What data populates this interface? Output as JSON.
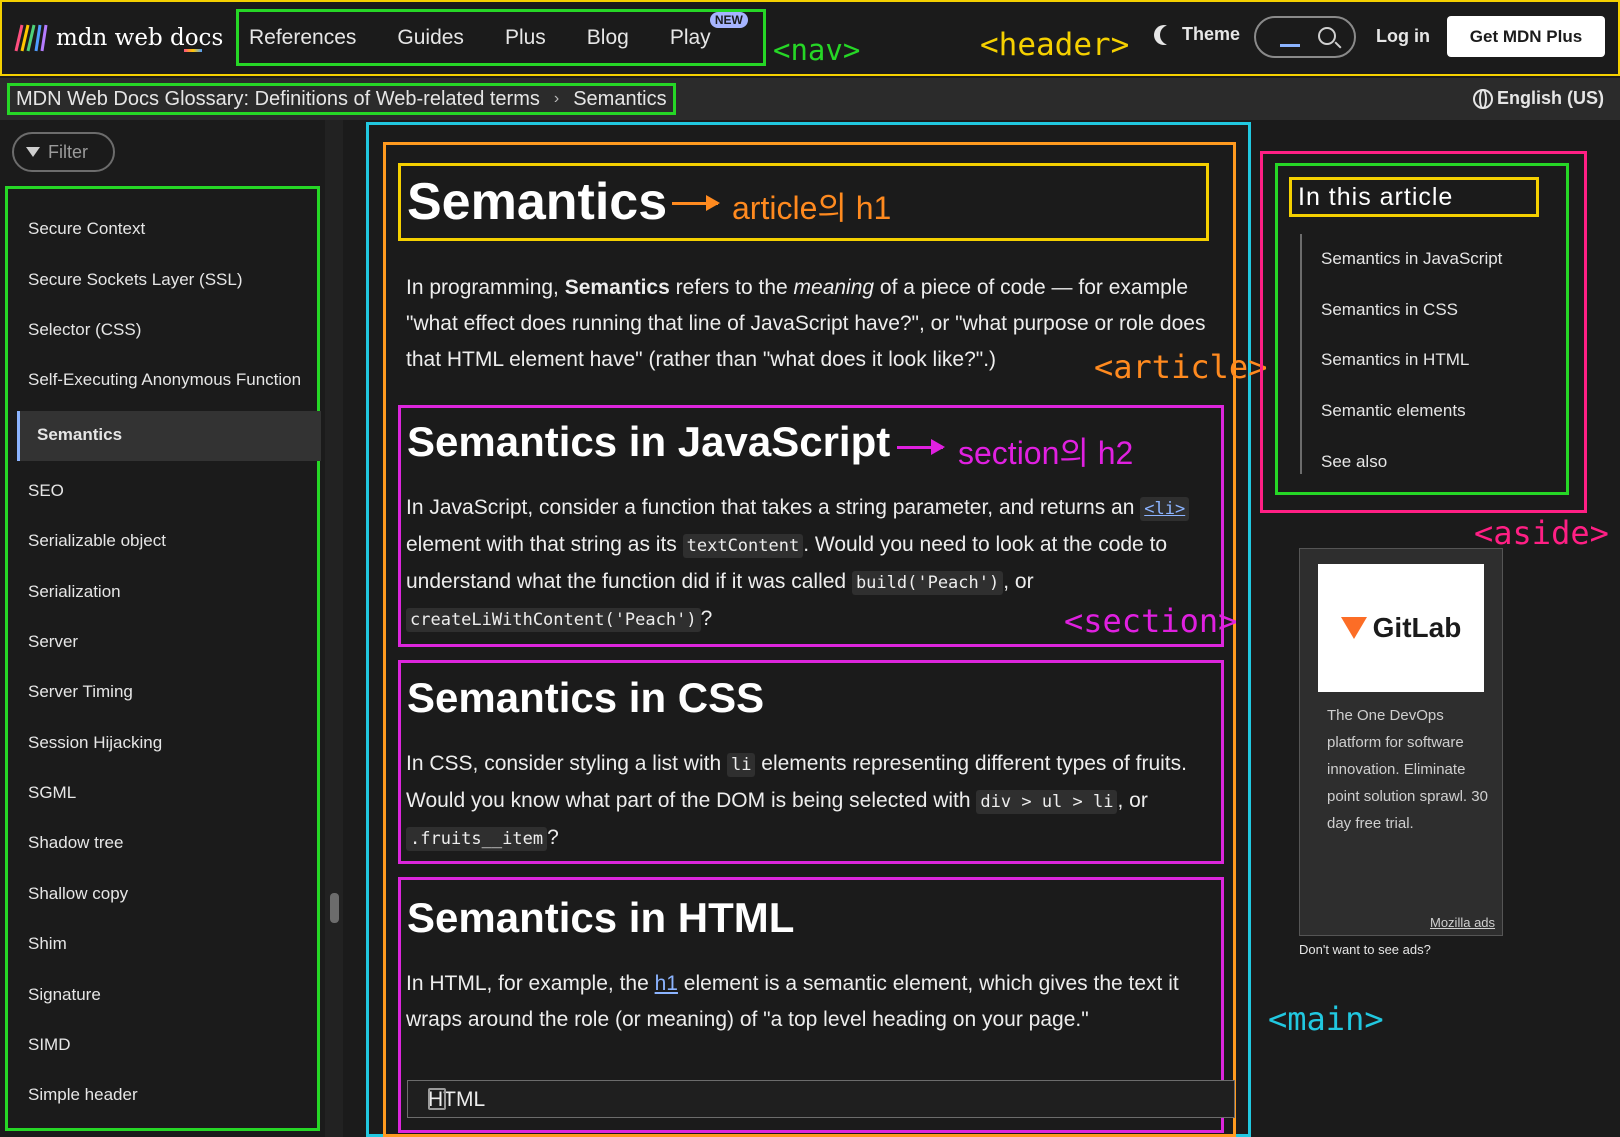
{
  "header": {
    "logo_text": "mdn web docs",
    "nav_items": [
      "References",
      "Guides",
      "Plus",
      "Blog",
      "Play"
    ],
    "play_badge": "NEW",
    "theme_label": "Theme",
    "login_label": "Log in",
    "get_plus_label": "Get MDN Plus"
  },
  "annotations": {
    "nav": "<nav>",
    "header": "<header>",
    "article_h1": "article의 h1",
    "article": "<article>",
    "section_h2": "section의 h2",
    "section": "<section>",
    "aside": "<aside>",
    "main": "<main>"
  },
  "breadcrumb": {
    "parent": "MDN Web Docs Glossary: Definitions of Web-related terms",
    "separator": "›",
    "current": "Semantics"
  },
  "language": "English (US)",
  "sidebar": {
    "filter_label": "Filter",
    "items": [
      "Secure Context",
      "Secure Sockets Layer (SSL)",
      "Selector (CSS)",
      "Self-Executing Anonymous Function",
      "Semantics",
      "SEO",
      "Serializable object",
      "Serialization",
      "Server",
      "Server Timing",
      "Session Hijacking",
      "SGML",
      "Shadow tree",
      "Shallow copy",
      "Shim",
      "Signature",
      "SIMD",
      "Simple header"
    ],
    "active_index": 4
  },
  "article": {
    "title": "Semantics",
    "intro": {
      "t1": "In programming, ",
      "b1": "Semantics",
      "t2": " refers to the ",
      "i1": "meaning",
      "t3": " of a piece of code — for example \"what effect does running that line of JavaScript have?\", or \"what purpose or role does that HTML element have\" (rather than \"what does it look like?\".)"
    },
    "sec_js": {
      "title": "Semantics in JavaScript",
      "t1": "In JavaScript, consider a function that takes a string parameter, and returns an ",
      "c1": "<li>",
      "t2": " element with that string as its ",
      "c2": "textContent",
      "t3": ". Would you need to look at the code to understand what the function did if it was called ",
      "c3": "build('Peach')",
      "t4": ", or ",
      "c4": "createLiWithContent('Peach')",
      "t5": "?"
    },
    "sec_css": {
      "title": "Semantics in CSS",
      "t1": "In CSS, consider styling a list with ",
      "c1": "li",
      "t2": " elements representing different types of fruits. Would you know what part of the DOM is being selected with ",
      "c2": "div > ul > li",
      "t3": ", or ",
      "c3": ".fruits__item",
      "t4": "?"
    },
    "sec_html": {
      "title": "Semantics in HTML",
      "t1": "In HTML, for example, the ",
      "link": "h1",
      "t2": " element is a semantic element, which gives the text it wraps around the role (or meaning) of \"a top level heading on your page.\"",
      "code_label": "HTML"
    }
  },
  "toc": {
    "title": "In this article",
    "items": [
      "Semantics in JavaScript",
      "Semantics in CSS",
      "Semantics in HTML",
      "Semantic elements",
      "See also"
    ]
  },
  "ad": {
    "brand": "GitLab",
    "text": "The One DevOps platform for software innovation. Eliminate point solution sprawl. 30 day free trial.",
    "mozilla_ads": "Mozilla ads",
    "no_ads": "Don't want to see ads?"
  }
}
